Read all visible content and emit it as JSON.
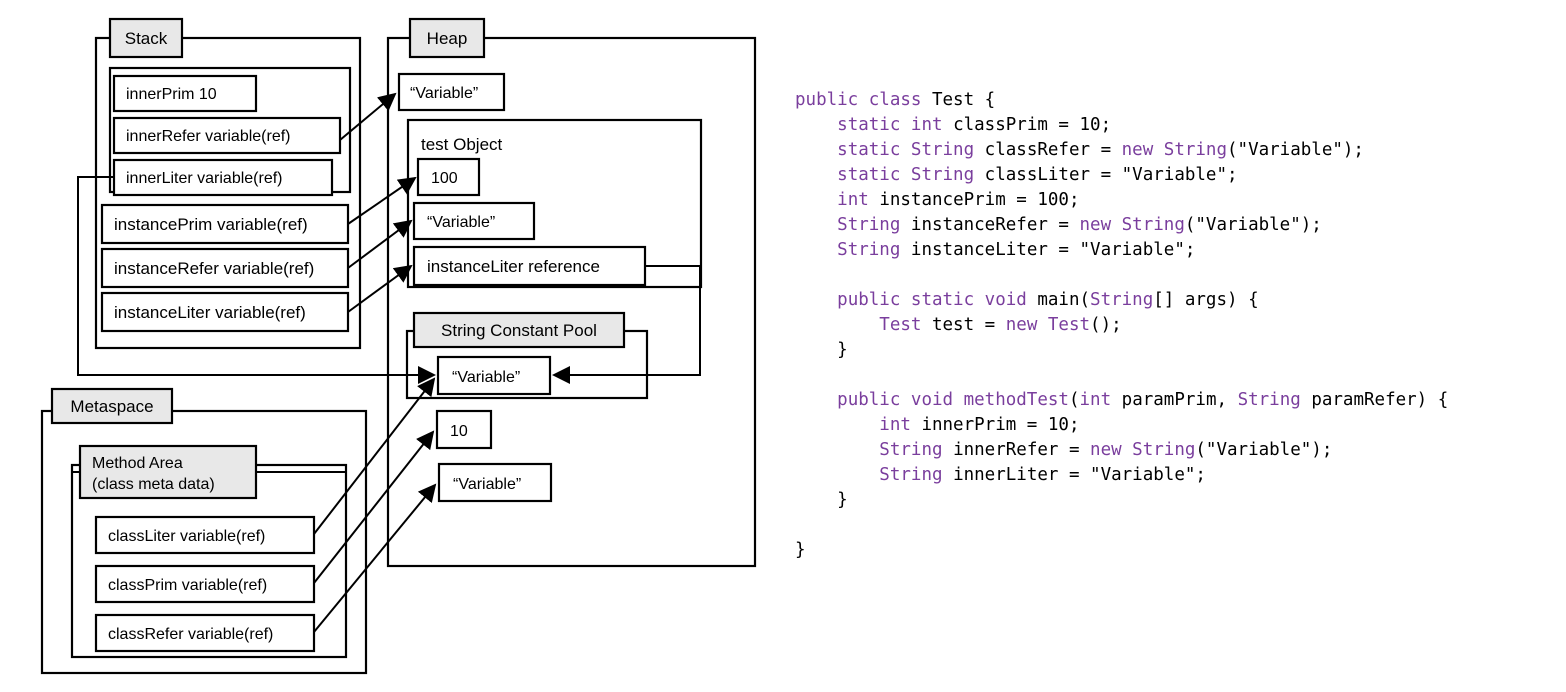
{
  "diagram": {
    "title": "JVM memory model (Stack / Heap / Metaspace) with Java source",
    "regions": {
      "stack": {
        "label": "Stack"
      },
      "heap": {
        "label": "Heap"
      },
      "metaspace": {
        "label": "Metaspace"
      },
      "method_area": {
        "label_line1": "Method Area",
        "label_line2": "(class meta data)"
      },
      "string_constant_pool": {
        "label": "String Constant Pool"
      },
      "test_object": {
        "label": "test Object"
      }
    },
    "stack_frame_inner": [
      {
        "id": "innerPrim",
        "text": "innerPrim 10"
      },
      {
        "id": "innerRefer",
        "text": "innerRefer variable(ref)"
      },
      {
        "id": "innerLiter",
        "text": "innerLiter variable(ref)"
      }
    ],
    "stack_frame_main": [
      {
        "id": "instancePrim",
        "text": "instancePrim variable(ref)"
      },
      {
        "id": "instanceRefer",
        "text": "instanceRefer variable(ref)"
      },
      {
        "id": "instanceLiter",
        "text": "instanceLiter variable(ref)"
      }
    ],
    "heap_items": [
      {
        "id": "heapStringVariable",
        "text": "“Variable”"
      }
    ],
    "test_object_fields": [
      {
        "id": "objPrim",
        "text": "100"
      },
      {
        "id": "objRefer",
        "text": "“Variable”"
      },
      {
        "id": "objLiter",
        "text": "instanceLiter reference"
      }
    ],
    "scp_items": [
      {
        "id": "scpVariable",
        "text": "“Variable”"
      }
    ],
    "heap_tail_items": [
      {
        "id": "heapTen",
        "text": "10"
      },
      {
        "id": "heapVariable2",
        "text": "“Variable”"
      }
    ],
    "method_area_items": [
      {
        "id": "classLiter",
        "text": "classLiter variable(ref)"
      },
      {
        "id": "classPrim",
        "text": "classPrim variable(ref)"
      },
      {
        "id": "classRefer",
        "text": "classRefer variable(ref)"
      }
    ],
    "colors": {
      "label_fill": "#e8e8e8",
      "stroke": "#000000",
      "code_keyword": "#7a3e9d",
      "code_plain": "#000000",
      "background": "#ffffff"
    }
  },
  "code": {
    "language": "Java",
    "lines": [
      [
        [
          "kw",
          "public class "
        ],
        [
          "plain",
          "Test {"
        ]
      ],
      [
        [
          "plain",
          "    "
        ],
        [
          "kw",
          "static int "
        ],
        [
          "plain",
          "classPrim = 10;"
        ]
      ],
      [
        [
          "plain",
          "    "
        ],
        [
          "kw",
          "static String "
        ],
        [
          "plain",
          "classRefer = "
        ],
        [
          "kw",
          "new String"
        ],
        [
          "plain",
          "(\"Variable\");"
        ]
      ],
      [
        [
          "plain",
          "    "
        ],
        [
          "kw",
          "static String "
        ],
        [
          "plain",
          "classLiter = \"Variable\";"
        ]
      ],
      [
        [
          "plain",
          "    "
        ],
        [
          "kw",
          "int "
        ],
        [
          "plain",
          "instancePrim = 100;"
        ]
      ],
      [
        [
          "plain",
          "    "
        ],
        [
          "kw",
          "String "
        ],
        [
          "plain",
          "instanceRefer = "
        ],
        [
          "kw",
          "new String"
        ],
        [
          "plain",
          "(\"Variable\");"
        ]
      ],
      [
        [
          "plain",
          "    "
        ],
        [
          "kw",
          "String "
        ],
        [
          "plain",
          "instanceLiter = \"Variable\";"
        ]
      ],
      [
        [
          "plain",
          ""
        ]
      ],
      [
        [
          "plain",
          "    "
        ],
        [
          "kw",
          "public static void "
        ],
        [
          "plain",
          "main("
        ],
        [
          "kw",
          "String"
        ],
        [
          "plain",
          "[] args) {"
        ]
      ],
      [
        [
          "plain",
          "        "
        ],
        [
          "kw",
          "Test "
        ],
        [
          "plain",
          "test = "
        ],
        [
          "kw",
          "new Test"
        ],
        [
          "plain",
          "();"
        ]
      ],
      [
        [
          "plain",
          "    }"
        ]
      ],
      [
        [
          "plain",
          ""
        ]
      ],
      [
        [
          "plain",
          "    "
        ],
        [
          "kw",
          "public void methodTest"
        ],
        [
          "plain",
          "("
        ],
        [
          "kw",
          "int "
        ],
        [
          "plain",
          "paramPrim, "
        ],
        [
          "kw",
          "String "
        ],
        [
          "plain",
          "paramRefer) {"
        ]
      ],
      [
        [
          "plain",
          "        "
        ],
        [
          "kw",
          "int "
        ],
        [
          "plain",
          "innerPrim = 10;"
        ]
      ],
      [
        [
          "plain",
          "        "
        ],
        [
          "kw",
          "String "
        ],
        [
          "plain",
          "innerRefer = "
        ],
        [
          "kw",
          "new String"
        ],
        [
          "plain",
          "(\"Variable\");"
        ]
      ],
      [
        [
          "plain",
          "        "
        ],
        [
          "kw",
          "String "
        ],
        [
          "plain",
          "innerLiter = \"Variable\";"
        ]
      ],
      [
        [
          "plain",
          "    }"
        ]
      ],
      [
        [
          "plain",
          ""
        ]
      ],
      [
        [
          "plain",
          "}"
        ]
      ]
    ]
  }
}
